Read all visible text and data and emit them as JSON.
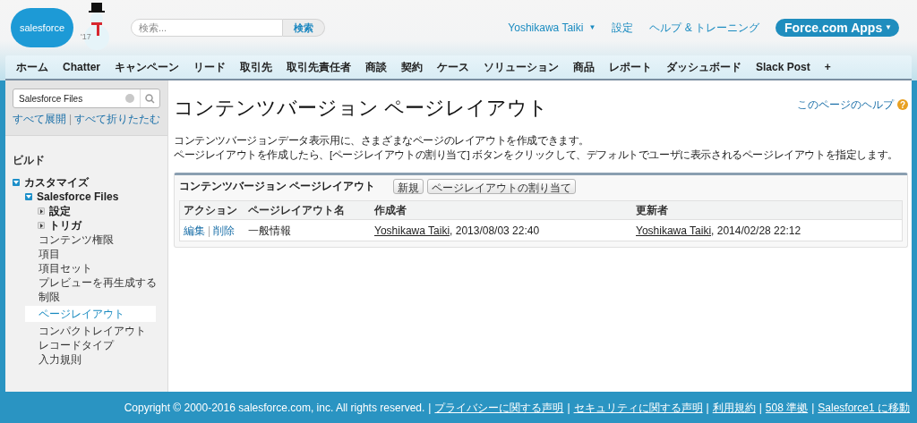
{
  "header": {
    "logo_text": "salesforce",
    "doodle_text": "'17",
    "search": {
      "placeholder": "検索...",
      "button": "検索"
    },
    "user_menu": {
      "label": "Yoshikawa Taiki",
      "caret": "▼"
    },
    "links": [
      "設定",
      "ヘルプ & トレーニング"
    ],
    "app_menu": {
      "label": "Force.com Apps",
      "caret": "▼"
    }
  },
  "tabs": [
    {
      "label": "ホーム"
    },
    {
      "label": "Chatter"
    },
    {
      "label": "キャンペーン"
    },
    {
      "label": "リード"
    },
    {
      "label": "取引先"
    },
    {
      "label": "取引先責任者"
    },
    {
      "label": "商談"
    },
    {
      "label": "契約"
    },
    {
      "label": "ケース"
    },
    {
      "label": "ソリューション"
    },
    {
      "label": "商品"
    },
    {
      "label": "レポート"
    },
    {
      "label": "ダッシュボード"
    },
    {
      "label": "Slack Post"
    },
    {
      "label": "+"
    }
  ],
  "sidebar": {
    "search_value": "Salesforce Files",
    "expand_all": "すべて展開",
    "separator": "|",
    "collapse_all": "すべて折りたたむ",
    "section": "ビルド",
    "items": [
      {
        "label": "カスタマイズ",
        "kind": "folder",
        "expanded": true,
        "children": [
          {
            "label": "Salesforce Files",
            "kind": "folder",
            "expanded": true,
            "children": [
              {
                "label": "設定",
                "kind": "folder",
                "expanded": false
              },
              {
                "label": "トリガ",
                "kind": "folder",
                "expanded": false
              },
              {
                "label": "コンテンツ権限",
                "kind": "leaf",
                "selected": false
              },
              {
                "label": "項目",
                "kind": "leaf",
                "selected": false
              },
              {
                "label": "項目セット",
                "kind": "leaf",
                "selected": false
              },
              {
                "label": "プレビューを再生成する",
                "kind": "leaf",
                "selected": false
              },
              {
                "label": "制限",
                "kind": "leaf",
                "selected": false
              },
              {
                "label": "ページレイアウト",
                "kind": "leaf",
                "selected": true
              },
              {
                "label": "コンパクトレイアウト",
                "kind": "leaf",
                "selected": false
              },
              {
                "label": "レコードタイプ",
                "kind": "leaf",
                "selected": false
              },
              {
                "label": "入力規則",
                "kind": "leaf",
                "selected": false
              }
            ]
          }
        ]
      }
    ]
  },
  "main": {
    "title": "コンテンツバージョン ページレイアウト",
    "help_link": {
      "label": "このページのヘルプ",
      "icon": "?"
    },
    "description": [
      "コンテンツバージョンデータ表示用に、さまざまなページのレイアウトを作成できます。",
      "ページレイアウトを作成したら、[ページレイアウトの割り当て] ボタンをクリックして、デフォルトでユーザに表示されるページレイアウトを指定します。"
    ],
    "panel": {
      "title": "コンテンツバージョン ページレイアウト",
      "buttons": [
        "新規",
        "ページレイアウトの割り当て"
      ],
      "table": {
        "columns": [
          "アクション",
          "ページレイアウト名",
          "作成者",
          "更新者"
        ],
        "rows": [
          {
            "actions": [
              "編集",
              "削除"
            ],
            "separator": "|",
            "name": "一般情報",
            "created_by": "Yoshikawa Taiki",
            "created_at": ", 2013/08/03 22:40",
            "modified_by": "Yoshikawa Taiki",
            "modified_at": ", 2014/02/28 22:12"
          }
        ]
      }
    }
  },
  "footer": {
    "copyright": "Copyright © 2000-2016 salesforce.com, inc. All rights reserved.",
    "separator": "|",
    "links": [
      "プライバシーに関する声明",
      "セキュリティに関する声明",
      "利用規約",
      "508 準拠",
      "Salesforce1 に移動"
    ]
  }
}
